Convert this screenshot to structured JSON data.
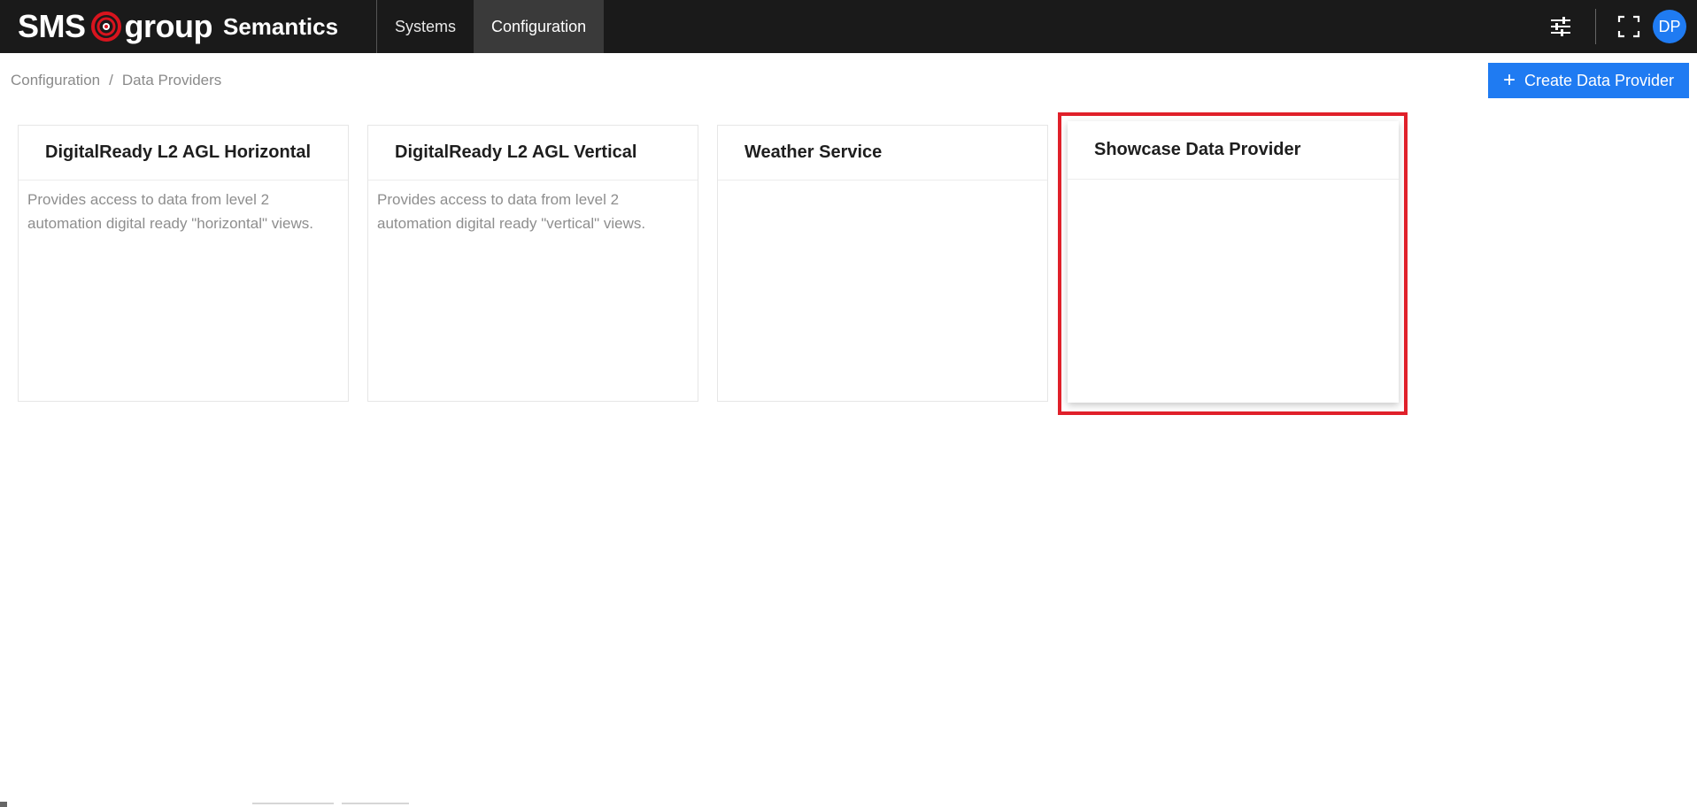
{
  "brand": {
    "sms": "SMS",
    "group": "group",
    "product": "Semantics"
  },
  "nav": {
    "items": [
      {
        "label": "Systems",
        "active": false
      },
      {
        "label": "Configuration",
        "active": true
      }
    ]
  },
  "topbar_icons": [
    "sliders-icon",
    "fullscreen-icon"
  ],
  "user": {
    "initials": "DP",
    "color": "#1f7bf2"
  },
  "breadcrumb": {
    "items": [
      "Configuration",
      "Data Providers"
    ],
    "separator": "/"
  },
  "actions": {
    "create_label": "Create Data Provider",
    "create_icon": "plus-icon"
  },
  "cards": [
    {
      "title": "DigitalReady L2 AGL Horizontal",
      "description": "Provides access to data from level 2 automation digital ready \"horizontal\" views."
    },
    {
      "title": "DigitalReady L2 AGL Vertical",
      "description": "Provides access to data from level 2 automation digital ready \"vertical\" views."
    },
    {
      "title": "Weather Service",
      "description": ""
    },
    {
      "title": "Showcase Data Provider",
      "description": "",
      "highlighted": true
    }
  ],
  "colors": {
    "topbar": "#1a1a1a",
    "accent": "#1f7bf2",
    "highlight": "#e0202a",
    "logo_red": "#d8141e"
  }
}
